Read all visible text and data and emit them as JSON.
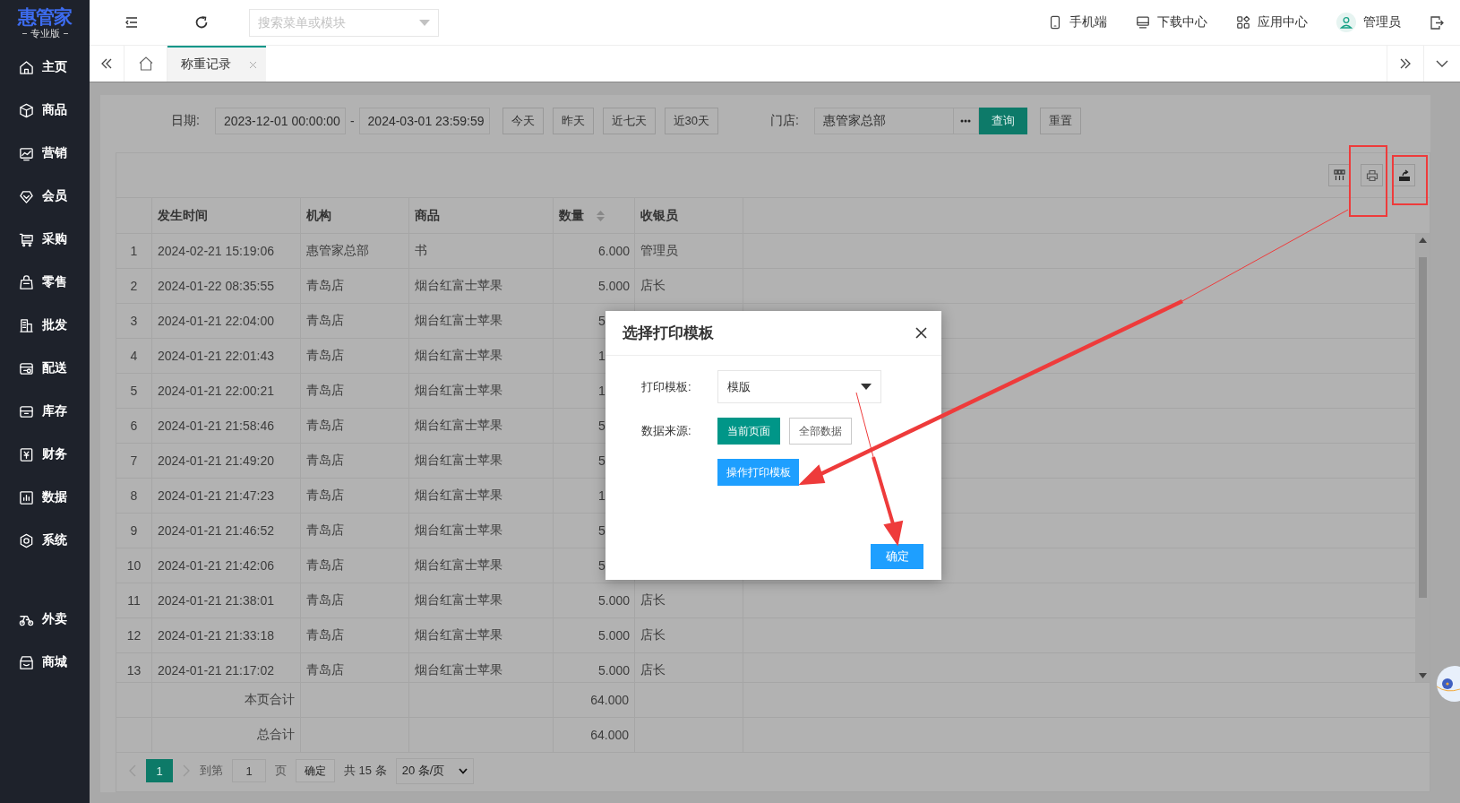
{
  "app": {
    "logo": "惠管家",
    "edition": "专业版"
  },
  "sidebar": {
    "groups": [
      [
        {
          "label": "主页"
        },
        {
          "label": "商品"
        },
        {
          "label": "营销"
        },
        {
          "label": "会员"
        },
        {
          "label": "采购"
        },
        {
          "label": "零售"
        },
        {
          "label": "批发"
        },
        {
          "label": "配送"
        },
        {
          "label": "库存"
        },
        {
          "label": "财务"
        },
        {
          "label": "数据"
        },
        {
          "label": "系统"
        }
      ],
      [
        {
          "label": "外卖"
        },
        {
          "label": "商城"
        }
      ]
    ]
  },
  "topbar": {
    "search": {
      "placeholder": "搜索菜单或模块"
    },
    "links": [
      {
        "label": "手机端"
      },
      {
        "label": "下载中心"
      },
      {
        "label": "应用中心"
      },
      {
        "label": "管理员"
      }
    ]
  },
  "tabs": [
    {
      "label": "称重记录",
      "selected": true
    }
  ],
  "filters": {
    "date_label": "日期:",
    "date_start": "2023-12-01 00:00:00",
    "date_separator": "-",
    "date_end": "2024-03-01 23:59:59",
    "quick_ranges": [
      "今天",
      "昨天",
      "近七天",
      "近30天"
    ],
    "store_label": "门店:",
    "store_value": "惠管家总部",
    "query": "查询",
    "reset": "重置"
  },
  "table": {
    "columns": [
      {
        "label": "发生时间",
        "sortable": false
      },
      {
        "label": "机构",
        "sortable": false
      },
      {
        "label": "商品",
        "sortable": false
      },
      {
        "label": "数量",
        "sortable": true
      },
      {
        "label": "收银员",
        "sortable": false
      }
    ],
    "rows": [
      {
        "index": "1",
        "time": "2024-02-21 15:19:06",
        "org": "惠管家总部",
        "goods": "书",
        "qty": "6.000",
        "cashier": "管理员"
      },
      {
        "index": "2",
        "time": "2024-01-22 08:35:55",
        "org": "青岛店",
        "goods": "烟台红富士苹果",
        "qty": "5.000",
        "cashier": "店长"
      },
      {
        "index": "3",
        "time": "2024-01-21 22:04:00",
        "org": "青岛店",
        "goods": "烟台红富士苹果",
        "qty": "5"
      },
      {
        "index": "4",
        "time": "2024-01-21 22:01:43",
        "org": "青岛店",
        "goods": "烟台红富士苹果",
        "qty": "1"
      },
      {
        "index": "5",
        "time": "2024-01-21 22:00:21",
        "org": "青岛店",
        "goods": "烟台红富士苹果",
        "qty": "1"
      },
      {
        "index": "6",
        "time": "2024-01-21 21:58:46",
        "org": "青岛店",
        "goods": "烟台红富士苹果",
        "qty": "5"
      },
      {
        "index": "7",
        "time": "2024-01-21 21:49:20",
        "org": "青岛店",
        "goods": "烟台红富士苹果",
        "qty": "5"
      },
      {
        "index": "8",
        "time": "2024-01-21 21:47:23",
        "org": "青岛店",
        "goods": "烟台红富士苹果",
        "qty": "1"
      },
      {
        "index": "9",
        "time": "2024-01-21 21:46:52",
        "org": "青岛店",
        "goods": "烟台红富士苹果",
        "qty": "5"
      },
      {
        "index": "10",
        "time": "2024-01-21 21:42:06",
        "org": "青岛店",
        "goods": "烟台红富士苹果",
        "qty": "5"
      },
      {
        "index": "11",
        "time": "2024-01-21 21:38:01",
        "org": "青岛店",
        "goods": "烟台红富士苹果",
        "qty": "5.000",
        "cashier": "店长"
      },
      {
        "index": "12",
        "time": "2024-01-21 21:33:18",
        "org": "青岛店",
        "goods": "烟台红富士苹果",
        "qty": "5.000",
        "cashier": "店长"
      },
      {
        "index": "13",
        "time": "2024-01-21 21:17:02",
        "org": "青岛店",
        "goods": "烟台红富士苹果",
        "qty": "5.000",
        "cashier": "店长"
      }
    ],
    "totals": [
      {
        "label": "本页合计",
        "qty": "64.000"
      },
      {
        "label": "总合计",
        "qty": "64.000"
      }
    ],
    "pagination": {
      "pages": [
        {
          "label": "1",
          "selected": true
        }
      ],
      "goto": "到第",
      "page_input": "1",
      "page_unit": "页",
      "confirm": "确定",
      "total": "共 15 条",
      "page_size": "20 条/页"
    }
  },
  "dialog": {
    "title": "选择打印模板",
    "template_label": "打印模板:",
    "template_value": "模版",
    "source_label": "数据来源:",
    "source_options": [
      {
        "label": "当前页面",
        "selected": true
      },
      {
        "label": "全部数据",
        "selected": false
      }
    ],
    "action": "操作打印模板",
    "ok": "确定"
  }
}
